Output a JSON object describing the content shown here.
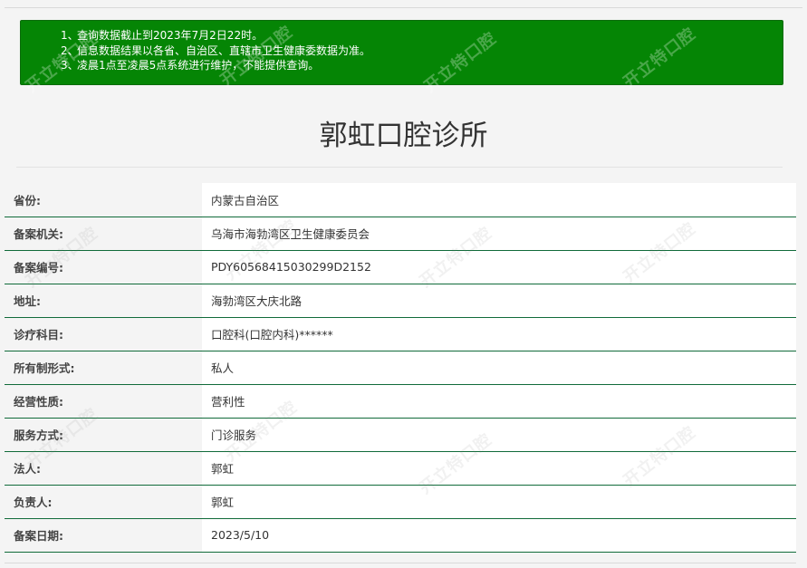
{
  "notice": {
    "items": [
      {
        "num": "1、",
        "text": "查询数据截止到2023年7月2日22时。"
      },
      {
        "num": "2、",
        "text": "信息数据结果以各省、自治区、直辖市卫生健康委数据为准。"
      },
      {
        "num": "3、",
        "text": "凌晨1点至凌晨5点系统进行维护，不能提供查询。"
      }
    ]
  },
  "page_title": "郭虹口腔诊所",
  "rows": [
    {
      "label": "省份:",
      "value": "内蒙古自治区"
    },
    {
      "label": "备案机关:",
      "value": "乌海市海勃湾区卫生健康委员会"
    },
    {
      "label": "备案编号:",
      "value": "PDY60568415030299D2152"
    },
    {
      "label": "地址:",
      "value": "海勃湾区大庆北路"
    },
    {
      "label": "诊疗科目:",
      "value": "口腔科(口腔内科)******"
    },
    {
      "label": "所有制形式:",
      "value": "私人"
    },
    {
      "label": "经营性质:",
      "value": "营利性"
    },
    {
      "label": "服务方式:",
      "value": "门诊服务"
    },
    {
      "label": "法人:",
      "value": "郭虹"
    },
    {
      "label": "负责人:",
      "value": "郭虹"
    },
    {
      "label": "备案日期:",
      "value": "2023/5/10"
    }
  ],
  "watermark": "开立特口腔",
  "colors": {
    "notice_bg": "#058505",
    "row_rule": "#116b3a",
    "page_bg": "#f4f4f4"
  }
}
